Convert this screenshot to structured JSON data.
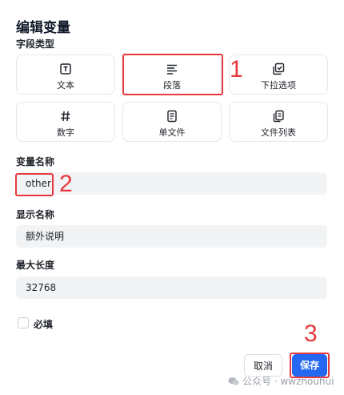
{
  "dialog": {
    "title": "编辑变量",
    "field_type_label": "字段类型",
    "types": [
      {
        "label": "文本",
        "icon": "text-box-icon"
      },
      {
        "label": "段落",
        "icon": "paragraph-icon"
      },
      {
        "label": "下拉选项",
        "icon": "dropdown-options-icon"
      },
      {
        "label": "数字",
        "icon": "hash-icon"
      },
      {
        "label": "单文件",
        "icon": "file-icon"
      },
      {
        "label": "文件列表",
        "icon": "files-icon"
      }
    ],
    "variable_name_label": "变量名称",
    "variable_name_value": "other",
    "display_name_label": "显示名称",
    "display_name_value": "额外说明",
    "max_length_label": "最大长度",
    "max_length_value": "32768",
    "required_label": "必填",
    "cancel_label": "取消",
    "save_label": "保存"
  },
  "annotations": {
    "n1": "1",
    "n2": "2",
    "n3": "3"
  },
  "watermark": {
    "text": "公众号 · wwzhouhui"
  },
  "colors": {
    "accent": "#2468f2",
    "annotation": "#e8383d",
    "input_bg": "#f2f3f5"
  }
}
